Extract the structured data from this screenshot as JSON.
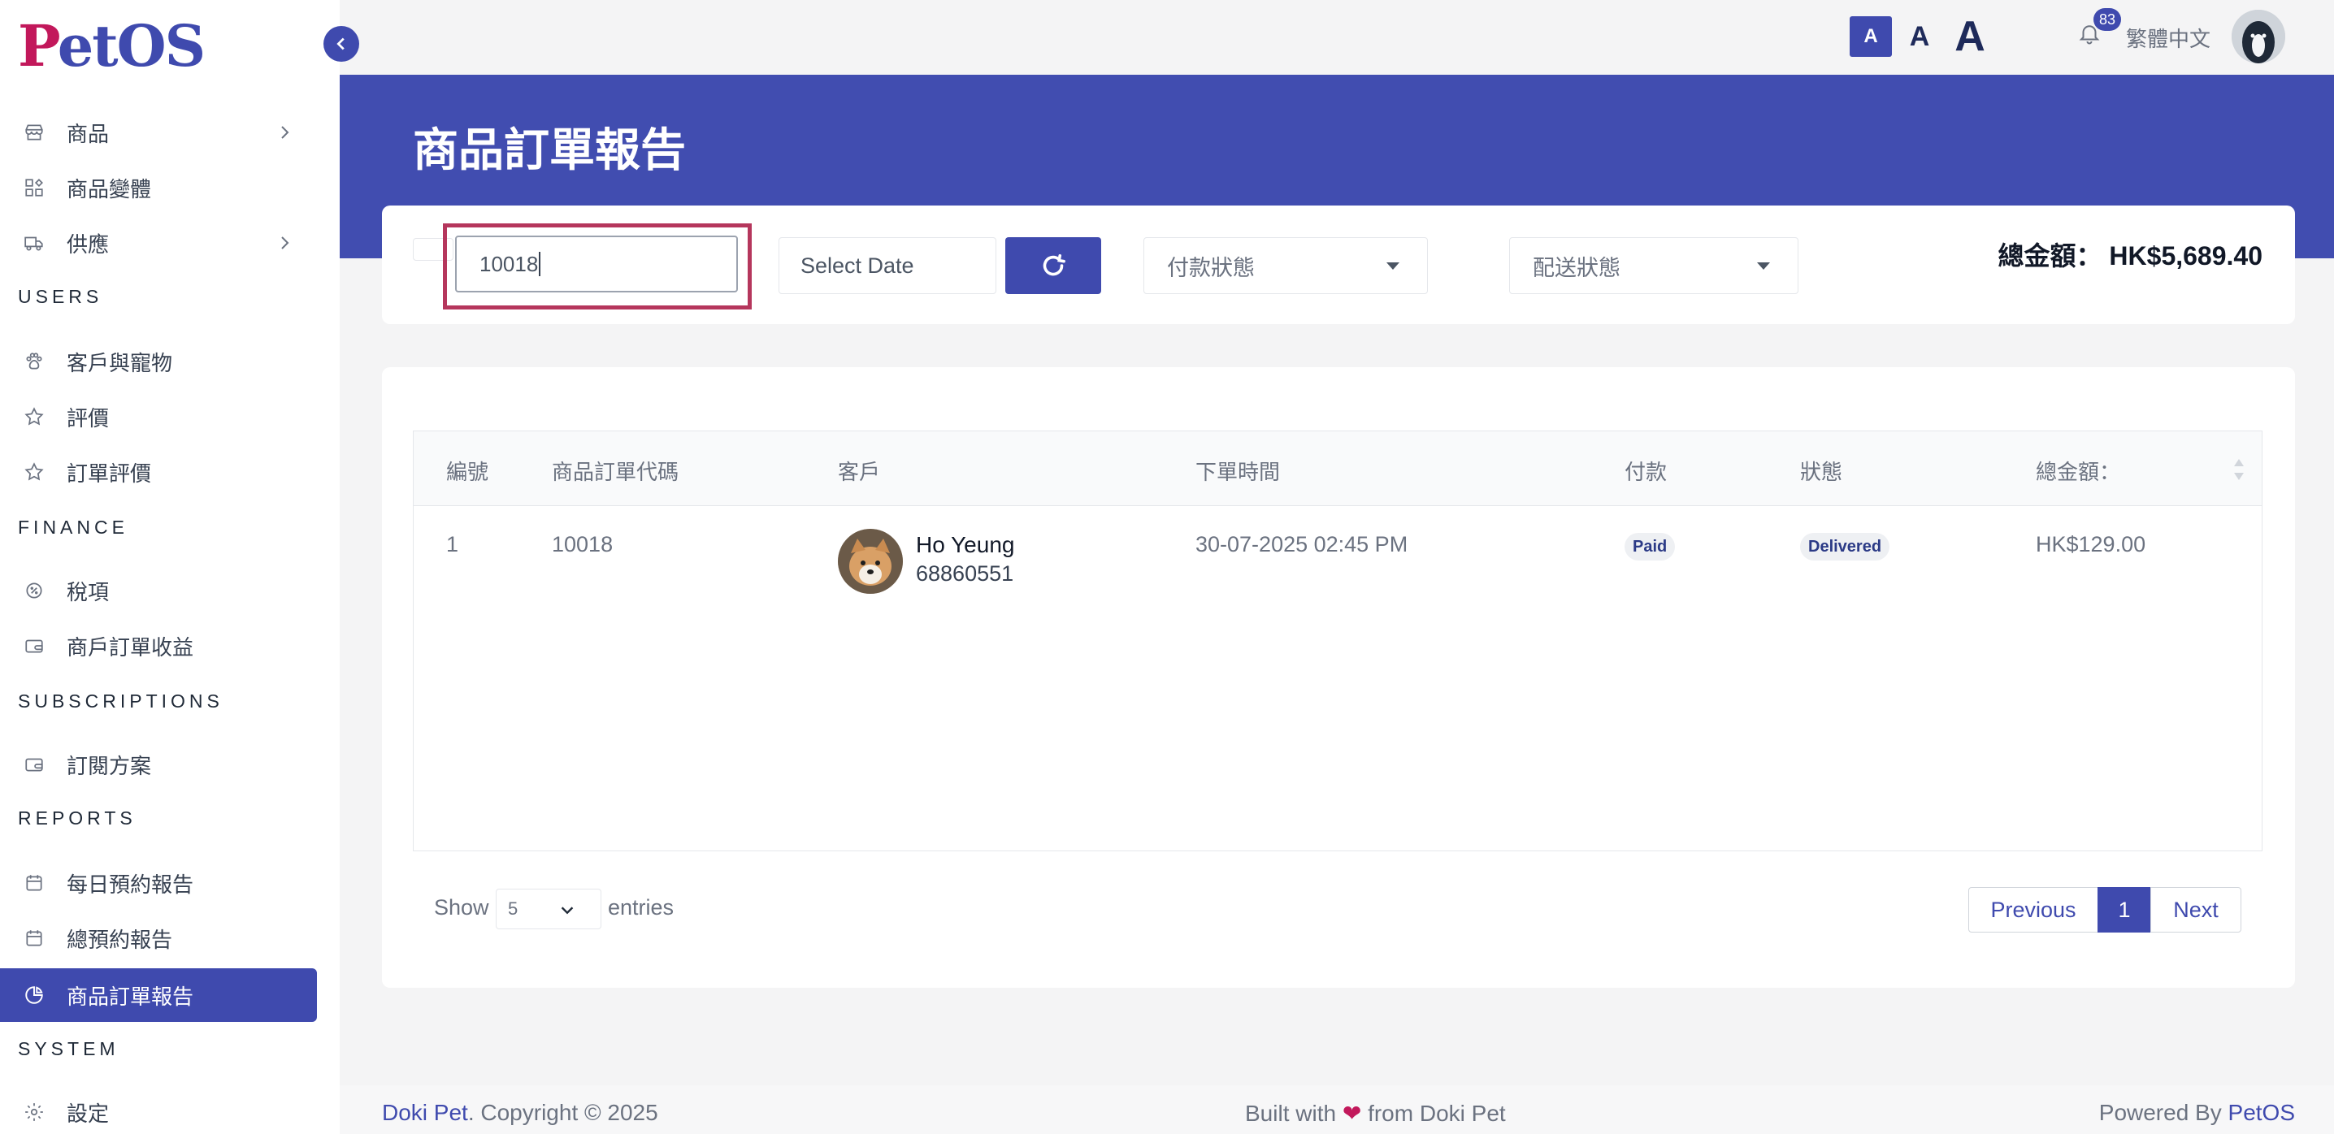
{
  "brand": {
    "logo_p": "P",
    "logo_rest": "etOS"
  },
  "sidebar": {
    "items": [
      {
        "label": "商品"
      },
      {
        "label": "商品變體"
      },
      {
        "label": "供應"
      },
      {
        "label": "客戶與寵物"
      },
      {
        "label": "評價"
      },
      {
        "label": "訂單評價"
      },
      {
        "label": "稅項"
      },
      {
        "label": "商戶訂單收益"
      },
      {
        "label": "訂閱方案"
      },
      {
        "label": "每日預約報告"
      },
      {
        "label": "總預約報告"
      },
      {
        "label": "商品訂單報告"
      },
      {
        "label": "設定"
      }
    ],
    "sections": {
      "users": "USERS",
      "finance": "FINANCE",
      "subscriptions": "SUBSCRIPTIONS",
      "reports": "REPORTS",
      "system": "SYSTEM"
    }
  },
  "topbar": {
    "font_small": "A",
    "font_mid": "A",
    "font_large": "A",
    "notification_count": "83",
    "language": "繁體中文"
  },
  "page": {
    "title": "商品訂單報告"
  },
  "filters": {
    "search_value": "10018",
    "date_placeholder": "Select Date",
    "payment_status_placeholder": "付款狀態",
    "delivery_status_placeholder": "配送狀態",
    "total_label": "總金額：",
    "total_value": "HK$5,689.40"
  },
  "table": {
    "headers": [
      "編號",
      "商品訂單代碼",
      "客戶",
      "下單時間",
      "付款",
      "狀態",
      "總金額："
    ],
    "rows": [
      {
        "no": "1",
        "order_code": "10018",
        "customer_name": "Ho Yeung",
        "customer_phone": "68860551",
        "order_time": "30-07-2025 02:45 PM",
        "payment": "Paid",
        "status": "Delivered",
        "total": "HK$129.00"
      }
    ]
  },
  "pagination": {
    "show_label": "Show",
    "entries_value": "5",
    "entries_label": "entries",
    "previous": "Previous",
    "current": "1",
    "next": "Next"
  },
  "footer": {
    "left_brand": "Doki Pet",
    "left_text": ". Copyright © 2025",
    "mid_prefix": "Built with ",
    "mid_suffix": " from Doki Pet",
    "right_prefix": "Powered By ",
    "right_brand": "PetOS"
  },
  "colors": {
    "accent": "#3f4aae",
    "brand_pink": "#c2185b",
    "highlight": "#b5365c"
  }
}
